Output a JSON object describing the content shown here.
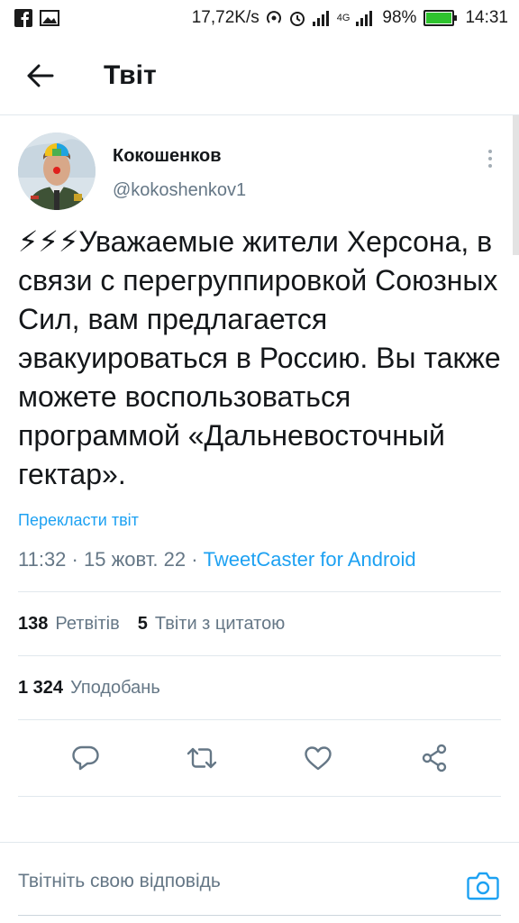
{
  "status_bar": {
    "net_speed": "17,72K/s",
    "network": "4G",
    "battery": "98%",
    "battery_level": 0.98,
    "time": "14:31",
    "icons": [
      "facebook-icon",
      "image-icon",
      "hotspot-icon",
      "alarm-icon",
      "signal-icon",
      "signal-icon",
      "battery-icon"
    ]
  },
  "header": {
    "title": "Твіт",
    "back_icon": "arrow-left-icon"
  },
  "tweet": {
    "author": {
      "name": "Кокошенков",
      "handle": "@kokoshenkov1"
    },
    "text": "⚡⚡⚡Уважаемые жители Херсона, в связи с перегруппировкой Союзных Сил, вам предлагается эвакуироваться в Россию. Вы также можете воспользоваться программой «Дальневосточный гектар».",
    "translate_label": "Перекласти твіт",
    "time": "11:32",
    "date": "15 жовт. 22",
    "source": "TweetCaster for Android",
    "retweets": {
      "count": "138",
      "label": "Ретвітів"
    },
    "quotes": {
      "count": "5",
      "label": "Твіти з цитатою"
    },
    "likes": {
      "count": "1 324",
      "label": "Уподобань"
    },
    "actions": [
      "reply-icon",
      "retweet-icon",
      "like-icon",
      "share-icon"
    ],
    "accent_color": "#1da1f2"
  },
  "reply": {
    "placeholder": "Твітніть свою відповідь",
    "camera_icon": "camera-icon"
  }
}
